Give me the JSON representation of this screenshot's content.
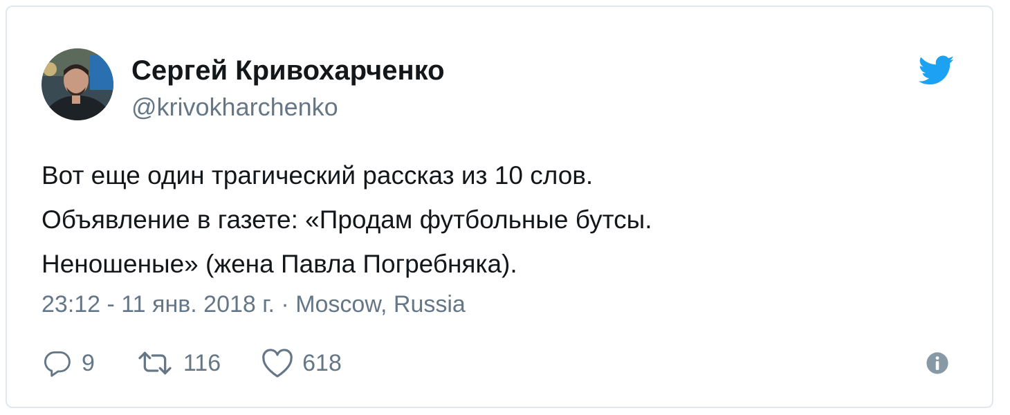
{
  "tweet": {
    "author_name": "Сергей Кривохарченко",
    "author_handle": "@krivokharchenko",
    "text_lines": [
      "Вот еще один трагический рассказ из 10 слов.",
      "Объявление в газете: «Продам футбольные бутсы.",
      "Неношеные» (жена Павла Погребняка)."
    ],
    "timestamp": "23:12 - 11 янв. 2018 г.",
    "separator": "·",
    "location": "Moscow, Russia",
    "replies": "9",
    "retweets": "116",
    "likes": "618"
  },
  "icons": {
    "brand": "twitter-bird-icon",
    "reply": "reply-icon",
    "retweet": "retweet-icon",
    "like": "heart-icon",
    "info": "info-icon"
  },
  "colors": {
    "twitter_blue": "#1da1f2",
    "text": "#14171a",
    "secondary": "#657786",
    "border": "#e1e8ed"
  }
}
